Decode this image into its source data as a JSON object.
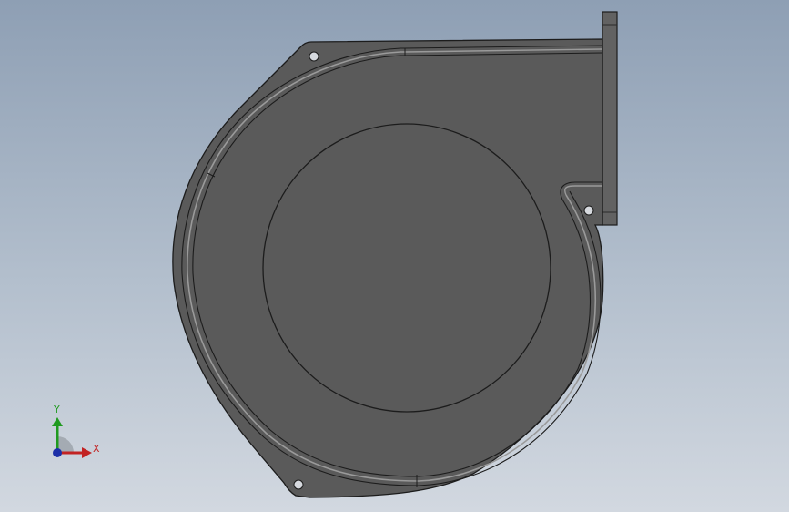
{
  "viewport": {
    "background_top": "#8e9fb4",
    "background_bottom": "#d2d8e0"
  },
  "model": {
    "body_color": "#5a5a5a",
    "edge_color": "#1c1c1c",
    "highlight_color": "#9a9a9a",
    "flange_color": "#626262"
  },
  "triad": {
    "x_label": "X",
    "y_label": "Y",
    "x_color": "#c22323",
    "y_color": "#1f9a1f",
    "z_color": "#1c2fa8"
  }
}
